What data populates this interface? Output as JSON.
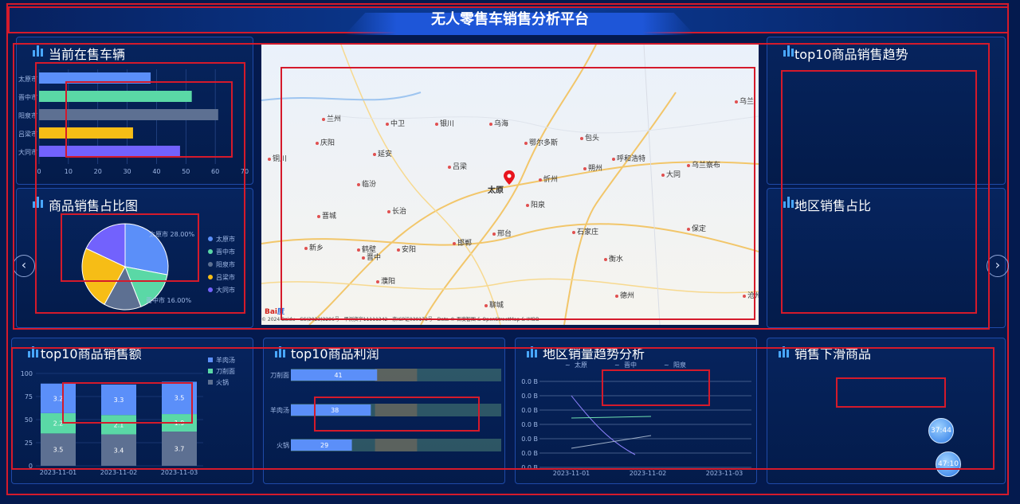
{
  "header": {
    "title": "无人零售车销售分析平台"
  },
  "panels": {
    "vehicles": "当前在售车辆",
    "share": "商品销售占比图",
    "trend": "top10商品销售趋势",
    "region_share": "地区销售占比",
    "sales": "top10商品销售额",
    "profit": "top10商品利润",
    "region_trend": "地区销量趋势分析",
    "decline": "销售下滑商品"
  },
  "colors": {
    "blue": "#5b8ff9",
    "green": "#5ad8a6",
    "gray": "#5d7092",
    "yellow": "#f6bd16",
    "purple": "#7262fd"
  },
  "chart_data": [
    {
      "type": "bar",
      "orientation": "horizontal",
      "categories": [
        "太原市",
        "晋中市",
        "阳泉市",
        "吕梁市",
        "大同市"
      ],
      "values": [
        38,
        52,
        61,
        32,
        48
      ],
      "xlim": [
        0,
        70
      ],
      "xticks": [
        "0",
        "10",
        "20",
        "30",
        "40",
        "50",
        "60",
        "70"
      ]
    },
    {
      "type": "pie",
      "labels": [
        "太原市",
        "晋中市",
        "阳泉市",
        "吕梁市",
        "大同市"
      ],
      "values": [
        28,
        16,
        14,
        24,
        18
      ],
      "slice_labels": [
        "太原市 28.00%",
        "晋中市 16.00%"
      ],
      "legend": [
        "太原市",
        "晋中市",
        "阳泉市",
        "吕梁市",
        "大同市"
      ]
    },
    {
      "type": "bar",
      "stacked": true,
      "categories": [
        "2023-11-01",
        "2023-11-02",
        "2023-11-03"
      ],
      "series": [
        {
          "name": "火锅",
          "values": [
            3.5,
            3.4,
            3.7
          ]
        },
        {
          "name": "刀削面",
          "values": [
            2.2,
            2.1,
            1.9
          ]
        },
        {
          "name": "羊肉汤",
          "values": [
            3.2,
            3.3,
            3.5
          ]
        }
      ],
      "yticks": [
        "0",
        "25",
        "50",
        "75",
        "100"
      ],
      "legend": [
        "羊肉汤",
        "刀削面",
        "火锅"
      ]
    },
    {
      "type": "bar",
      "orientation": "horizontal",
      "categories": [
        "刀削面",
        "羊肉汤",
        "火锅"
      ],
      "values": [
        41,
        38,
        29
      ]
    },
    {
      "type": "line",
      "x": [
        "2023-11-01",
        "2023-11-02",
        "2023-11-03"
      ],
      "yticks": [
        "0.0 B",
        "0.0 B",
        "0.0 B",
        "0.0 B",
        "0.0 B",
        "0.0 B",
        "0.0 B"
      ],
      "legend": [
        "太原",
        "晋中",
        "阳泉"
      ]
    }
  ],
  "map": {
    "marker": "太原",
    "cities": [
      "兰州",
      "中卫",
      "银川",
      "乌海",
      "鄂尔多斯",
      "包头",
      "呼和浩特",
      "乌兰察布",
      "庆阳",
      "延安",
      "吕梁",
      "忻州",
      "大同",
      "朔州",
      "临汾",
      "长治",
      "晋中",
      "阳泉",
      "石家庄",
      "保定",
      "邢台",
      "邯郸",
      "衡水",
      "晋城",
      "新乡",
      "鹤壁",
      "安阳",
      "濮阳",
      "德州",
      "聊城",
      "沧州",
      "铜川",
      "乌兰"
    ],
    "copyright": "© 2024 Baidu - GS(2023)3206号 - 甲测资字11111342 - 京ICP证030173号 - Data © 百度智图 & OpenStreetMap & IMDB"
  },
  "bubbles": [
    "37:44",
    "47:10"
  ]
}
